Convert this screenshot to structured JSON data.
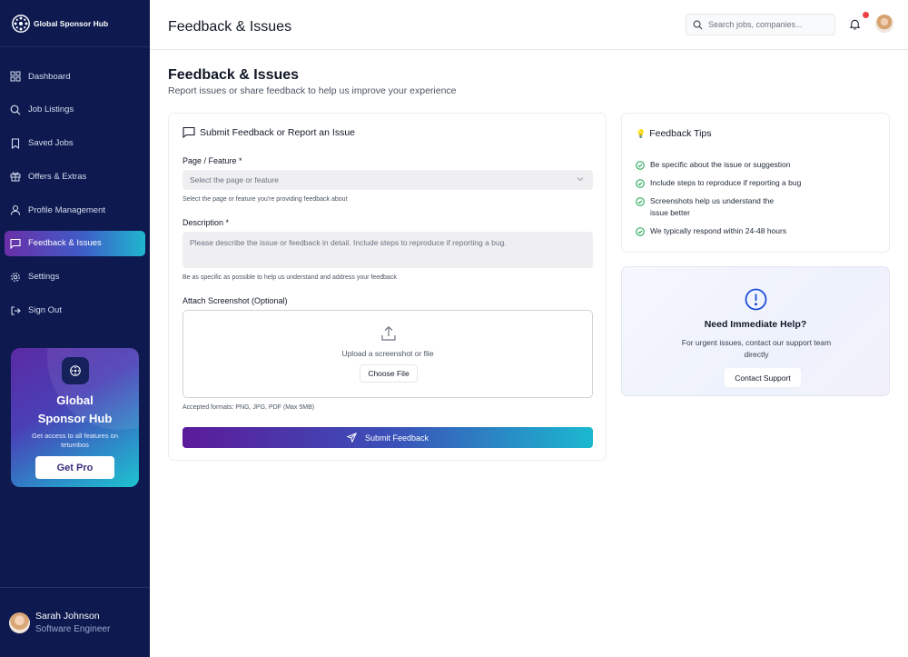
{
  "sidebar": {
    "brand": "Global Sponsor Hub",
    "items": [
      {
        "label": "Dashboard",
        "icon": "dashboard-icon"
      },
      {
        "label": "Job Listings",
        "icon": "search-icon"
      },
      {
        "label": "Saved Jobs",
        "icon": "bookmark-icon"
      },
      {
        "label": "Offers & Extras",
        "icon": "gift-icon"
      },
      {
        "label": "Profile Management",
        "icon": "user-icon"
      },
      {
        "label": "Feedback & Issues",
        "icon": "message-icon",
        "active": true
      },
      {
        "label": "Settings",
        "icon": "gear-icon"
      },
      {
        "label": "Sign Out",
        "icon": "sign-out-icon"
      }
    ],
    "promo": {
      "title_line1": "Global",
      "title_line2": "Sponsor Hub",
      "text": "Get access to all features on tetumbos",
      "button": "Get Pro"
    },
    "user": {
      "name": "Sarah Johnson",
      "role": "Software Engineer"
    }
  },
  "header": {
    "title": "Feedback & Issues",
    "search_placeholder": "Search jobs, companies...",
    "notification_dot_color": "#ef4444"
  },
  "main": {
    "title": "Feedback & Issues",
    "subtitle": "Report issues or share feedback to help us improve your experience",
    "form": {
      "heading": "Submit Feedback or Report an Issue",
      "page_label": "Page / Feature *",
      "page_placeholder": "Select the page or feature",
      "page_hint": "Select the page or feature you're providing feedback about",
      "desc_label": "Description *",
      "desc_placeholder": "Please describe the issue or feedback in detail. Include steps to reproduce if reporting a bug.",
      "desc_hint": "Be as specific as possible to help us understand and address your feedback",
      "attach_label": "Attach Screenshot (Optional)",
      "upload_text": "Upload a screenshot or file",
      "choose_button": "Choose File",
      "formats_hint": "Accepted formats: PNG, JPG, PDF (Max 5MB)",
      "submit_button": "Submit Feedback"
    },
    "tips": {
      "icon": "💡",
      "title": "Feedback Tips",
      "items": [
        "Be specific about the issue or suggestion",
        "Include steps to reproduce if reporting a bug",
        "Screenshots help us understand the issue better",
        "We typically respond within 24-48 hours"
      ]
    },
    "help": {
      "title": "Need Immediate Help?",
      "text": "For urgent issues, contact our support team directly",
      "button": "Contact Support"
    }
  },
  "colors": {
    "sidebar_bg": "#0e1a4f",
    "accent_purple": "#5b1b9a",
    "accent_cyan": "#1bb8cf",
    "check_green": "#16a34a",
    "help_blue": "#1d4ed8"
  }
}
